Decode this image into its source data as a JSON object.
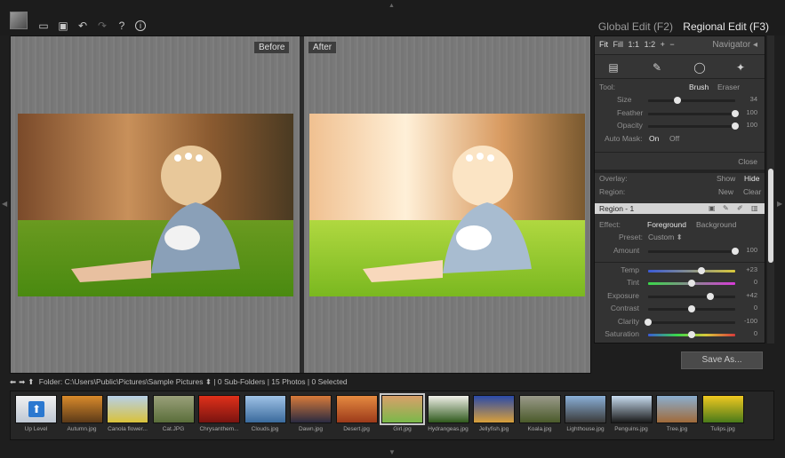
{
  "toolbar": {
    "icons": [
      "folder-open-icon",
      "save-icon",
      "undo-icon",
      "redo-icon",
      "help-icon",
      "info-icon"
    ],
    "help_glyph": "?",
    "info_glyph": "i"
  },
  "mode_tabs": {
    "global": "Global Edit (F2)",
    "regional": "Regional Edit (F3)"
  },
  "canvas": {
    "before_label": "Before",
    "after_label": "After"
  },
  "navigator": {
    "fit": "Fit",
    "fill": "Fill",
    "one_to_one": "1:1",
    "one_to_two": "1:2",
    "zoom_in": "+",
    "zoom_out": "−",
    "title": "Navigator",
    "collapse": "◂"
  },
  "tool_strip": {
    "icons": [
      "gradient-tool-icon",
      "brush-tool-icon",
      "lasso-tool-icon",
      "magic-wand-icon"
    ]
  },
  "brush": {
    "tool_label": "Tool:",
    "brush": "Brush",
    "eraser": "Eraser",
    "size_label": "Size",
    "size_value": "34",
    "size_fraction": 0.34,
    "feather_label": "Feather",
    "feather_value": "100",
    "feather_fraction": 1.0,
    "opacity_label": "Opacity",
    "opacity_value": "100",
    "opacity_fraction": 1.0,
    "automask_label": "Auto Mask:",
    "on": "On",
    "off": "Off",
    "close": "Close"
  },
  "overlay": {
    "label": "Overlay:",
    "show": "Show",
    "hide": "Hide",
    "region_label": "Region:",
    "new": "New",
    "clear": "Clear"
  },
  "region": {
    "name": "Region - 1"
  },
  "effect": {
    "label": "Effect:",
    "foreground": "Foreground",
    "background": "Background",
    "preset_label": "Preset:",
    "preset_value": "Custom ⬍",
    "amount_label": "Amount",
    "amount_value": "100",
    "amount_fraction": 1.0,
    "sliders": [
      {
        "label": "Temp",
        "value": "+23",
        "fraction": 0.615
      },
      {
        "label": "Tint",
        "value": "0",
        "fraction": 0.5
      },
      {
        "label": "Exposure",
        "value": "+42",
        "fraction": 0.71
      },
      {
        "label": "Contrast",
        "value": "0",
        "fraction": 0.5
      },
      {
        "label": "Clarity",
        "value": "-100",
        "fraction": 0.0
      },
      {
        "label": "Saturation",
        "value": "0",
        "fraction": 0.5
      }
    ]
  },
  "save_button": "Save As...",
  "folder_bar": {
    "label": "Folder:",
    "path": "C:\\Users\\Public\\Pictures\\Sample Pictures ⬍",
    "subfolders": "| 0 Sub-Folders",
    "photos": "| 15 Photos",
    "selected": "| 0 Selected"
  },
  "filmstrip": [
    {
      "caption": "Up Level"
    },
    {
      "caption": "Autumn.jpg",
      "colors": [
        "#d98a2b",
        "#5c3a18"
      ]
    },
    {
      "caption": "Canola flower...",
      "colors": [
        "#b7d0e8",
        "#d9c23a"
      ]
    },
    {
      "caption": "Cat.JPG",
      "colors": [
        "#9aa07a",
        "#5a6e3a"
      ]
    },
    {
      "caption": "Chrysanthem...",
      "colors": [
        "#e0301a",
        "#7a1410"
      ]
    },
    {
      "caption": "Clouds.jpg",
      "colors": [
        "#9fc2e6",
        "#3a6a9c"
      ]
    },
    {
      "caption": "Dawn.jpg",
      "colors": [
        "#d87a3a",
        "#2a2a40"
      ]
    },
    {
      "caption": "Desert.jpg",
      "colors": [
        "#e58a40",
        "#9c3a1a"
      ]
    },
    {
      "caption": "Girl.jpg",
      "colors": [
        "#d9a06a",
        "#7ab84a"
      ]
    },
    {
      "caption": "Hydrangeas.jpg",
      "colors": [
        "#f0f0e8",
        "#2f5a1c"
      ]
    },
    {
      "caption": "Jellyfish.jpg",
      "colors": [
        "#2a4aa8",
        "#d9a03a"
      ]
    },
    {
      "caption": "Koala.jpg",
      "colors": [
        "#9a9a8a",
        "#4a5a2a"
      ]
    },
    {
      "caption": "Lighthouse.jpg",
      "colors": [
        "#8ab0d8",
        "#3a3a3a"
      ]
    },
    {
      "caption": "Penguins.jpg",
      "colors": [
        "#c8dcf0",
        "#1a1a1a"
      ]
    },
    {
      "caption": "Tree.jpg",
      "colors": [
        "#8aaed0",
        "#a06a3a"
      ]
    },
    {
      "caption": "Tulips.jpg",
      "colors": [
        "#f0c820",
        "#4a7a1a"
      ]
    }
  ]
}
